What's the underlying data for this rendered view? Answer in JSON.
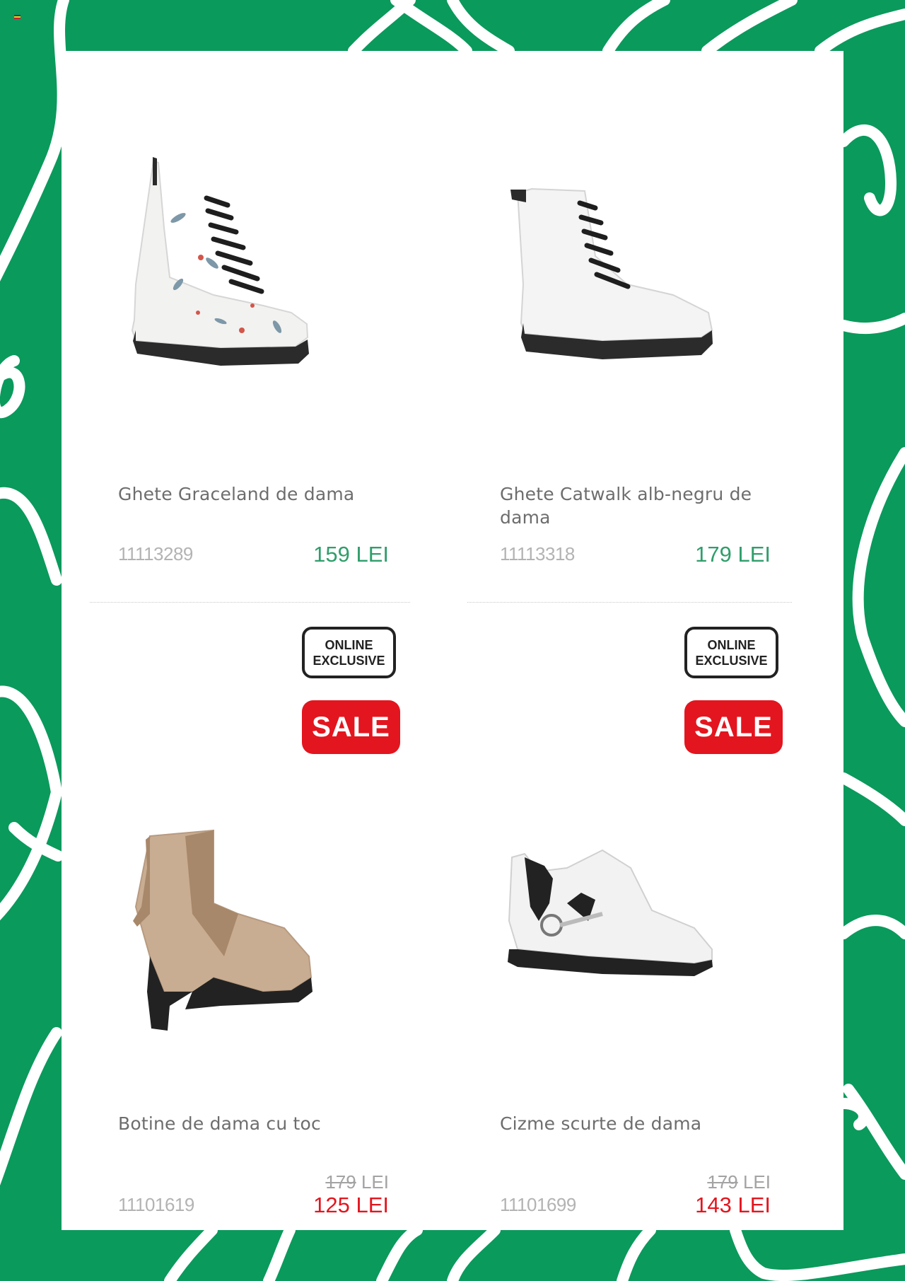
{
  "colors": {
    "background_green": "#0a9a5c",
    "price_green": "#2f9e6b",
    "sale_red": "#e3151e"
  },
  "products": [
    {
      "title": "Ghete Graceland de dama",
      "code": "11113289",
      "price": "159 LEI",
      "image_icon": "white-floral-lace-up-boot-image"
    },
    {
      "title": "Ghete Catwalk alb-negru de dama",
      "code": "11113318",
      "price": "179 LEI",
      "image_icon": "white-lace-up-boot-image"
    },
    {
      "title": "Botine de dama cu toc",
      "code": "11101619",
      "old_price_value": "179",
      "old_price_unit": "LEI",
      "price": "125 LEI",
      "badge_online_line1": "ONLINE",
      "badge_online_line2": "EXCLUSIVE",
      "badge_sale": "SALE",
      "image_icon": "beige-heeled-ankle-boot-image"
    },
    {
      "title": "Cizme scurte de dama",
      "code": "11101699",
      "old_price_value": "179",
      "old_price_unit": "LEI",
      "price": "143 LEI",
      "badge_online_line1": "ONLINE",
      "badge_online_line2": "EXCLUSIVE",
      "badge_sale": "SALE",
      "image_icon": "white-buckle-ankle-boot-image"
    }
  ]
}
